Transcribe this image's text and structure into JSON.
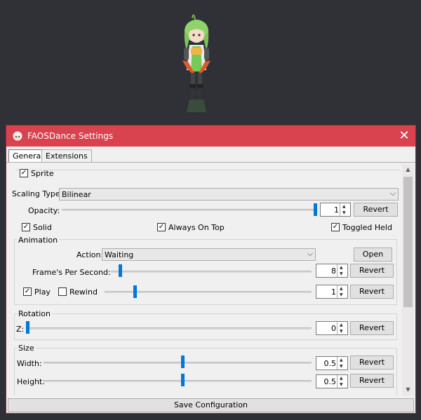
{
  "window": {
    "title": "FAOSDance Settings",
    "close_glyph": "✕"
  },
  "tabs": [
    {
      "label": "General"
    },
    {
      "label": "Extensions"
    }
  ],
  "sprite": {
    "label": "Sprite",
    "checked": true,
    "scaling_type_label": "Scaling Type:",
    "scaling_type_value": "Bilinear",
    "opacity_label": "Opacity:",
    "opacity_value": "1",
    "opacity_level": 1.0,
    "revert": "Revert",
    "solid_label": "Solid",
    "always_on_top_label": "Always On Top",
    "toggled_held_label": "Toggled Held"
  },
  "animation": {
    "title": "Animation",
    "action_label": "Action:",
    "action_value": "Waiting",
    "open_label": "Open",
    "fps_label": "Frame's Per Second:",
    "fps_value": "8",
    "fps_level": 0.04,
    "play_label": "Play",
    "rewind_label": "Rewind",
    "speed_value": "1",
    "speed_level": 0.14,
    "revert": "Revert"
  },
  "rotation": {
    "title": "Rotation",
    "z_label": "Z:",
    "z_value": "0",
    "z_level": 0.0,
    "revert": "Revert"
  },
  "size": {
    "title": "Size",
    "width_label": "Width:",
    "width_value": "0.5",
    "width_level": 0.52,
    "height_label": "Height:",
    "height_value": "0.5",
    "height_level": 0.52,
    "revert": "Revert"
  },
  "footer": {
    "save_label": "Save Configuration"
  },
  "icons": {
    "check": "✓",
    "combo_arrow": "⌵",
    "spin_up": "▲",
    "spin_down": "▼",
    "scroll_up": "▲",
    "scroll_down": "▼"
  },
  "colors": {
    "titlebar": "#d9424f",
    "accent": "#0078d7",
    "background": "#2e3036"
  }
}
